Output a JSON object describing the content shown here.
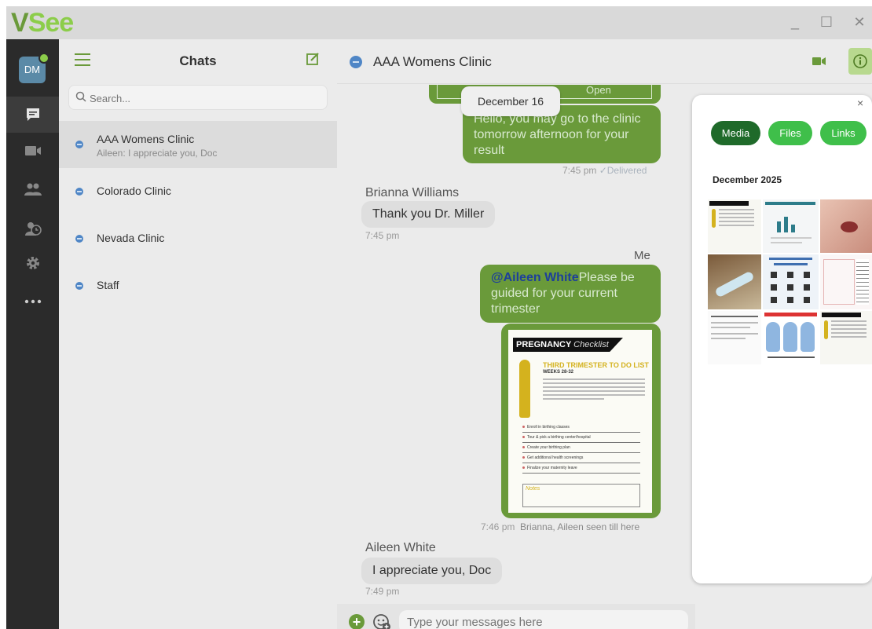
{
  "app": {
    "logo": "VSee",
    "minimize": "_",
    "maximize": "☐",
    "close": "✕"
  },
  "user": {
    "initials": "DM"
  },
  "chats_panel": {
    "title": "Chats",
    "search_placeholder": "Search...",
    "items": [
      {
        "name": "AAA Womens Clinic",
        "preview": "Aileen: I appreciate you, Doc"
      },
      {
        "name": "Colorado Clinic",
        "preview": ""
      },
      {
        "name": "Nevada Clinic",
        "preview": ""
      },
      {
        "name": "Staff",
        "preview": ""
      }
    ]
  },
  "conversation": {
    "title": "AAA Womens Clinic",
    "top_card_action": "Open",
    "date_separator": "December 16",
    "messages": [
      {
        "sender": "",
        "text": "Hello, you may go to the clinic tomorrow afternoon for your result",
        "time": "7:45 pm",
        "status": "✓Delivered"
      },
      {
        "sender": "Brianna Williams",
        "text": "Thank you Dr. Miller",
        "time": "7:45 pm"
      },
      {
        "sender": "Me",
        "mention": "@Aileen White",
        "text": "Please be guided for your current trimester"
      },
      {
        "sender": "",
        "time": "7:46 pm",
        "seen": "Brianna, Aileen seen till here"
      },
      {
        "sender": "Aileen White",
        "text": "I appreciate you, Doc",
        "time": "7:49 pm"
      }
    ],
    "attachment": {
      "heading": "PREGNANCY",
      "heading_script": "Checklist",
      "title": "THIRD TRIMESTER TO DO LIST",
      "subtitle": "WEEKS 28-32",
      "items": [
        "Enroll in birthing classes",
        "Tour & pick a birthing center/hospital",
        "Create your birthing plan",
        "Get additional health screenings",
        "Finalize your maternity leave"
      ],
      "notes_label": "Notes"
    },
    "input_placeholder": "Type your messages here"
  },
  "media_panel": {
    "close": "×",
    "tabs": {
      "media": "Media",
      "files": "Files",
      "links": "Links"
    },
    "section": "December 2025"
  },
  "colors": {
    "brand_green": "#6a9a3a",
    "light_green": "#8ccd4a",
    "rail": "#2b2b2b",
    "chat_blue": "#4f86c6"
  },
  "icons": [
    "chat-icon",
    "video-icon",
    "contacts-icon",
    "history-icon",
    "settings-icon",
    "more-icon",
    "compose-icon",
    "search-icon",
    "info-icon",
    "plus-icon",
    "emoji-icon"
  ]
}
